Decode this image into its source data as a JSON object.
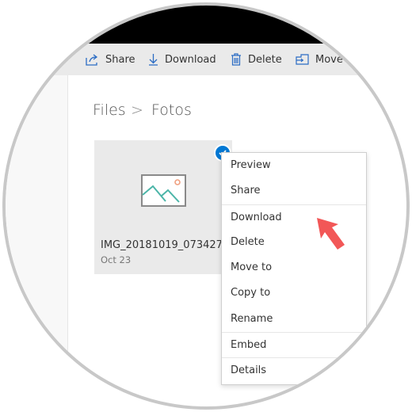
{
  "toolbar": {
    "share": "Share",
    "download": "Download",
    "delete": "Delete",
    "move": "Move"
  },
  "breadcrumb": {
    "root": "Files",
    "separator": ">",
    "current": "Fotos"
  },
  "file": {
    "name": "IMG_20181019_073427...",
    "date": "Oct 23",
    "selected": true
  },
  "context_menu": {
    "items": [
      "Preview",
      "Share",
      "Download",
      "Delete",
      "Move to",
      "Copy to",
      "Rename",
      "Embed",
      "Details"
    ]
  },
  "colors": {
    "accent": "#0078d4",
    "arrow": "#f25757",
    "toolbar_bg": "#eaeaea"
  }
}
